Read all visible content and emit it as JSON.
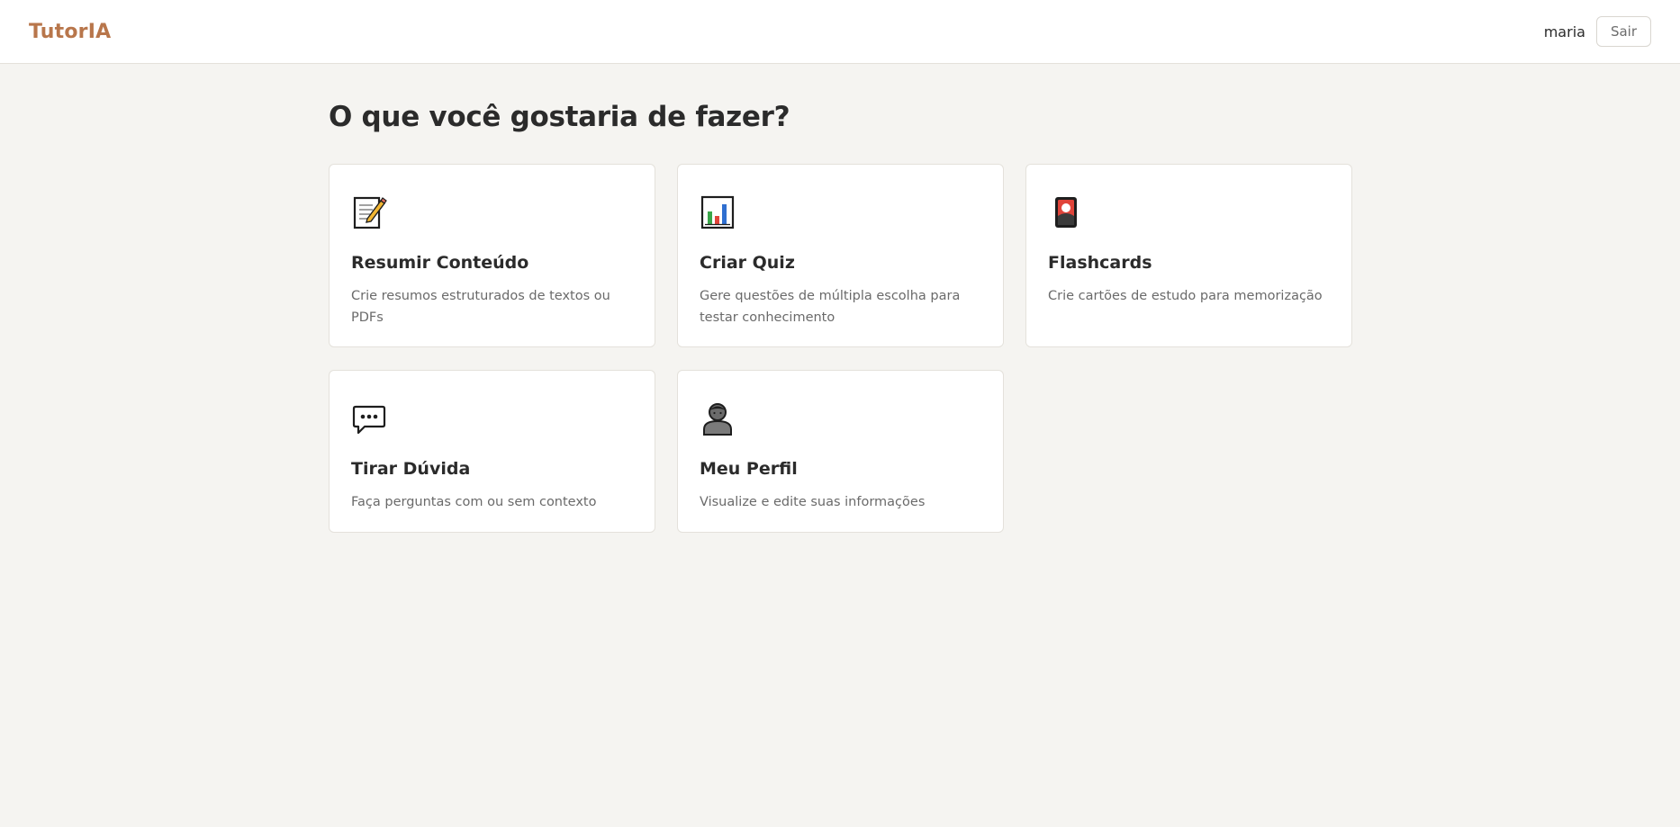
{
  "header": {
    "brand": "TutorIA",
    "username": "maria",
    "logout_label": "Sair"
  },
  "main": {
    "title": "O que você gostaria de fazer?",
    "cards": [
      {
        "icon": "memo-icon",
        "title": "Resumir Conteúdo",
        "description": "Crie resumos estruturados de textos ou PDFs"
      },
      {
        "icon": "bar-chart-icon",
        "title": "Criar Quiz",
        "description": "Gere questões de múltipla escolha para testar conhecimento"
      },
      {
        "icon": "flashcard-icon",
        "title": "Flashcards",
        "description": "Crie cartões de estudo para memorização"
      },
      {
        "icon": "speech-bubble-icon",
        "title": "Tirar Dúvida",
        "description": "Faça perguntas com ou sem contexto"
      },
      {
        "icon": "person-icon",
        "title": "Meu Perfil",
        "description": "Visualize e edite suas informações"
      }
    ]
  },
  "colors": {
    "brand": "#b8764b",
    "background": "#f5f4f1",
    "card": "#ffffff"
  }
}
